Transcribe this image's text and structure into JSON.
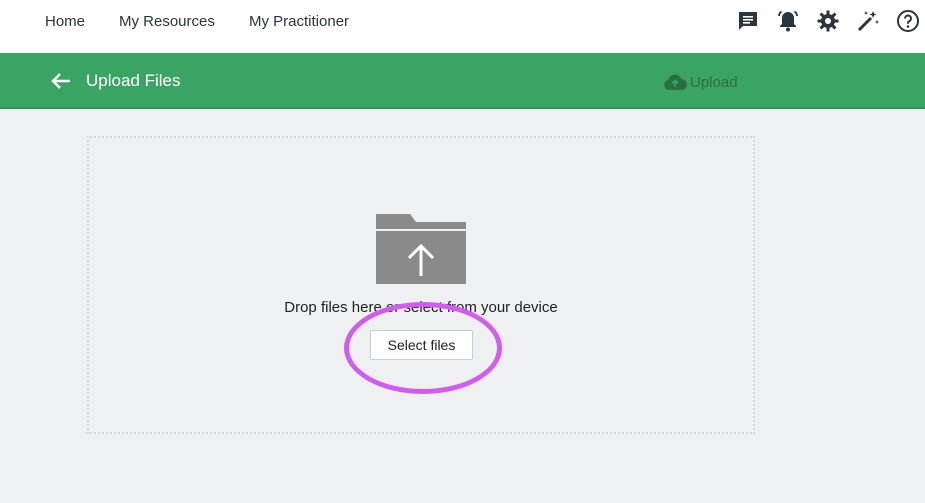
{
  "nav": {
    "links": [
      "Home",
      "My Resources",
      "My Practitioner"
    ],
    "icons": [
      "chat-icon",
      "bell-icon",
      "gear-icon",
      "magic-wand-icon",
      "help-icon"
    ]
  },
  "header": {
    "title": "Upload Files",
    "upload_label": "Upload",
    "accent_color": "#3aa464"
  },
  "dropzone": {
    "text": "Drop files here or select from your device",
    "select_label": "Select files",
    "icon": "folder-upload-icon"
  },
  "annotation": {
    "color": "#d35cf0"
  }
}
